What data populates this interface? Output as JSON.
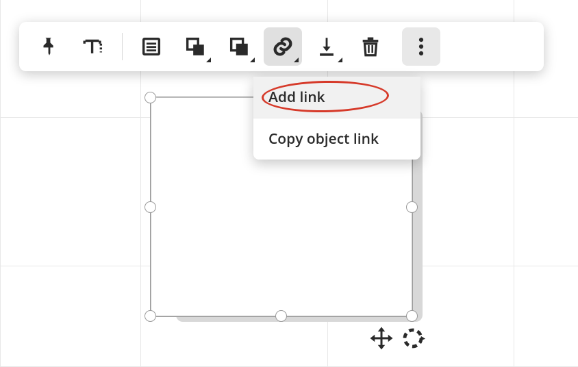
{
  "toolbar": {
    "pin": {
      "name": "pin-icon"
    },
    "text": {
      "name": "text-style-icon"
    },
    "list": {
      "name": "list-icon"
    },
    "arrange": {
      "name": "arrange-icon"
    },
    "copy": {
      "name": "copy-icon"
    },
    "link": {
      "name": "link-icon",
      "active": true
    },
    "download": {
      "name": "download-icon"
    },
    "delete": {
      "name": "delete-icon"
    },
    "more": {
      "name": "more-icon"
    }
  },
  "dropdown": {
    "items": [
      {
        "label": "Add link",
        "highlighted": true
      },
      {
        "label": "Copy object link",
        "highlighted": false
      }
    ]
  },
  "object_controls": {
    "move": {
      "name": "move-icon"
    },
    "rotate": {
      "name": "rotate-icon"
    }
  },
  "colors": {
    "icon": "#2a2a2a",
    "highlight_ring": "#d63a2a",
    "toolbar_active_bg": "#e0e0e0"
  }
}
